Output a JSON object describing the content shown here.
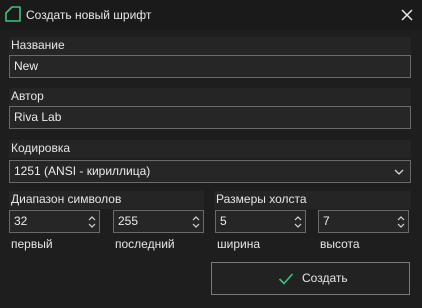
{
  "window": {
    "title": "Создать новый шрифт",
    "accent_color": "#3cc47c"
  },
  "fields": {
    "name": {
      "label": "Название",
      "value": "New"
    },
    "author": {
      "label": "Автор",
      "value": "Riva Lab"
    },
    "encoding": {
      "label": "Кодировка",
      "value": "1251 (ANSI - кириллица)"
    }
  },
  "char_range": {
    "label": "Диапазон символов",
    "first": {
      "value": "32",
      "caption": "первый"
    },
    "last": {
      "value": "255",
      "caption": "последний"
    }
  },
  "canvas_size": {
    "label": "Размеры холста",
    "width": {
      "value": "5",
      "caption": "ширина"
    },
    "height": {
      "value": "7",
      "caption": "высота"
    }
  },
  "actions": {
    "create_label": "Создать"
  },
  "icons": [
    "app-icon",
    "close-icon",
    "chevron-down-icon",
    "spin-up-icon",
    "spin-down-icon",
    "check-icon"
  ]
}
